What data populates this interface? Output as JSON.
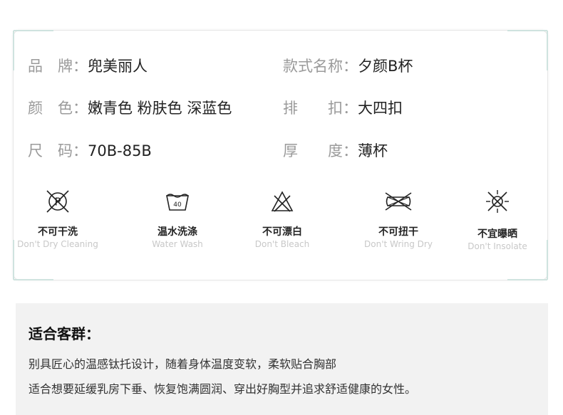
{
  "specs": {
    "brand_label": "品　牌：",
    "brand_value": "兜美丽人",
    "style_label": "款式名称：",
    "style_value": "夕颜B杯",
    "color_label": "颜　色：",
    "color_value": "嫩青色 粉肤色 深蓝色",
    "clasp_label": "排　　扣：",
    "clasp_value": "大四扣",
    "size_label": "尺　码：",
    "size_value": "70B-85B",
    "thickness_label": "厚　　度：",
    "thickness_value": "薄杯"
  },
  "care": [
    {
      "cn": "不可干洗",
      "en": "Don't Dry Cleaning",
      "icon": "no-dry-clean-icon"
    },
    {
      "cn": "温水洗涤",
      "en": "Water Wash",
      "icon": "water-wash-icon",
      "temp": "40"
    },
    {
      "cn": "不可漂白",
      "en": "Don't Bleach",
      "icon": "no-bleach-icon"
    },
    {
      "cn": "不可扭干",
      "en": "Don't Wring Dry",
      "icon": "no-wring-icon"
    },
    {
      "cn": "不宜曝晒",
      "en": "Don't Insolate",
      "icon": "no-sun-icon"
    }
  ],
  "audience": {
    "title": "适合客群：",
    "line1": "别具匠心的温感钛托设计，随着身体温度变软，柔软贴合胸部",
    "line2": "适合想要延缓乳房下垂、恢复饱满圆润、穿出好胸型并追求舒适健康的女性。"
  },
  "colors": {
    "accent": "#cfe3df",
    "label_gray": "#9a9a9a",
    "english_gray": "#c8c8c8",
    "panel_bg": "#f2f2f2"
  }
}
